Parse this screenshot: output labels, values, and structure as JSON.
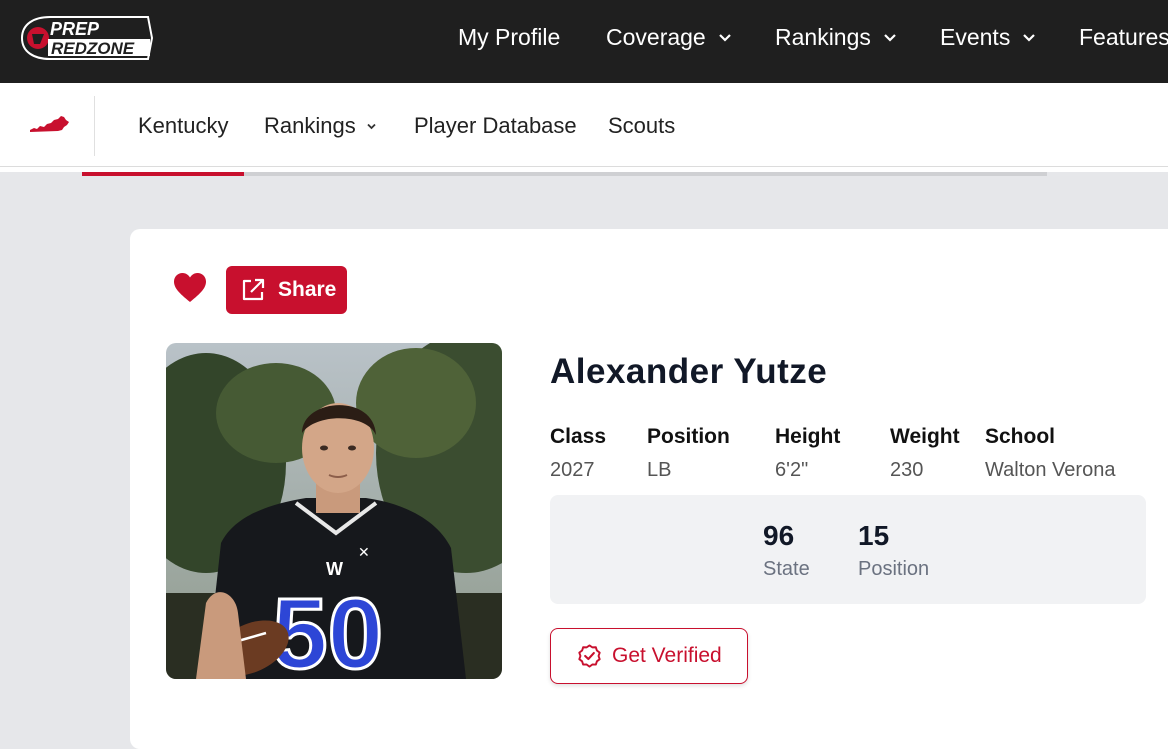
{
  "brand": {
    "logo_text_line1": "PREP",
    "logo_text_line2": "REDZONE",
    "accent_color": "#c8102e"
  },
  "topnav": {
    "items": [
      {
        "label": "My Profile",
        "has_dropdown": false
      },
      {
        "label": "Coverage",
        "has_dropdown": true
      },
      {
        "label": "Rankings",
        "has_dropdown": true
      },
      {
        "label": "Events",
        "has_dropdown": true
      },
      {
        "label": "Features",
        "has_dropdown": false
      }
    ]
  },
  "subnav": {
    "state_icon": "kentucky-state-icon",
    "items": [
      {
        "label": "Kentucky",
        "has_dropdown": false
      },
      {
        "label": "Rankings",
        "has_dropdown": true
      },
      {
        "label": "Player Database",
        "has_dropdown": false
      },
      {
        "label": "Scouts",
        "has_dropdown": false
      }
    ],
    "progress_fraction": 0.168
  },
  "profile": {
    "favorite_icon": "heart-icon",
    "share_label": "Share",
    "name": "Alexander Yutze",
    "attributes": [
      {
        "label": "Class",
        "value": "2027"
      },
      {
        "label": "Position",
        "value": "LB"
      },
      {
        "label": "Height",
        "value": "6'2\""
      },
      {
        "label": "Weight",
        "value": "230"
      },
      {
        "label": "School",
        "value": "Walton Verona"
      }
    ],
    "rankings": [
      {
        "value": "96",
        "caption": "State"
      },
      {
        "value": "15",
        "caption": "Position"
      }
    ],
    "jersey_number": "50",
    "verify_label": "Get Verified"
  }
}
